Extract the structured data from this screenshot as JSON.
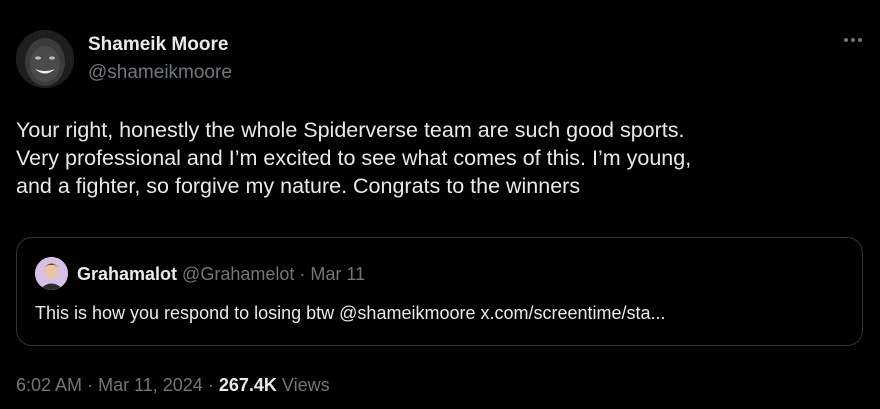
{
  "tweet": {
    "author": {
      "display_name": "Shameik Moore",
      "handle": "@shameikmoore"
    },
    "text": "Your right, honestly the whole Spiderverse team are such good sports.\nVery professional and I’m excited to see what comes of this. I’m young,\nand a fighter, so forgive my nature. Congrats to the winners",
    "time": "6:02 AM",
    "date": "Mar 11, 2024",
    "separator": "·",
    "views_count": "267.4K",
    "views_label": "Views"
  },
  "quoted_tweet": {
    "display_name": "Grahamalot",
    "handle": "@Grahamelot",
    "date": "Mar 11",
    "separator": "·",
    "text": "This is how you respond to losing btw @shameikmoore x.com/screentime/sta..."
  },
  "icons": {
    "more": "more-horizontal-icon"
  }
}
